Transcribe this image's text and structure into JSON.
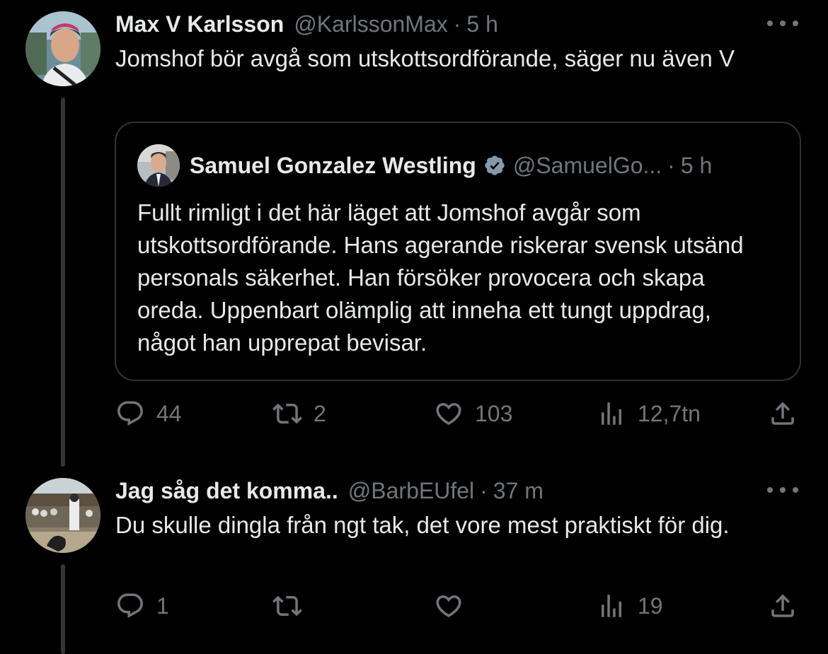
{
  "tweets": [
    {
      "name": "Max V Karlsson",
      "handle": "@KarlssonMax",
      "dot": "·",
      "time": "5 h",
      "text": "Jomshof bör avgå som utskottsordförande, säger nu även V",
      "quote": {
        "name": "Samuel Gonzalez Westling",
        "handle": "@SamuelGo...",
        "dot": "·",
        "time": "5 h",
        "text": "Fullt rimligt i det här läget att Jomshof avgår som utskottsordförande. Hans agerande riskerar svensk utsänd personals säkerhet. Han försöker provocera och skapa oreda. Uppenbart olämplig att inneha ett tungt uppdrag, något han upprepat bevisar."
      },
      "stats": {
        "replies": "44",
        "retweets": "2",
        "likes": "103",
        "views": "12,7tn"
      }
    },
    {
      "name": "Jag såg det komma..",
      "handle": "@BarbEUfel",
      "dot": "·",
      "time": "37 m",
      "text": "Du skulle dingla från ngt tak, det vore mest praktiskt för dig.",
      "stats": {
        "replies": "1",
        "retweets": "",
        "likes": "",
        "views": "19"
      }
    }
  ],
  "icons": {
    "more": "more-horizontal-icon",
    "reply": "reply-icon",
    "retweet": "retweet-icon",
    "like": "heart-icon",
    "views": "views-icon",
    "share": "share-icon",
    "verified": "verified-badge-icon"
  },
  "colors": {
    "background": "#000000",
    "text": "#e7e9ea",
    "secondary": "#71767b",
    "border": "#2f3336",
    "verified": "#829aab"
  }
}
